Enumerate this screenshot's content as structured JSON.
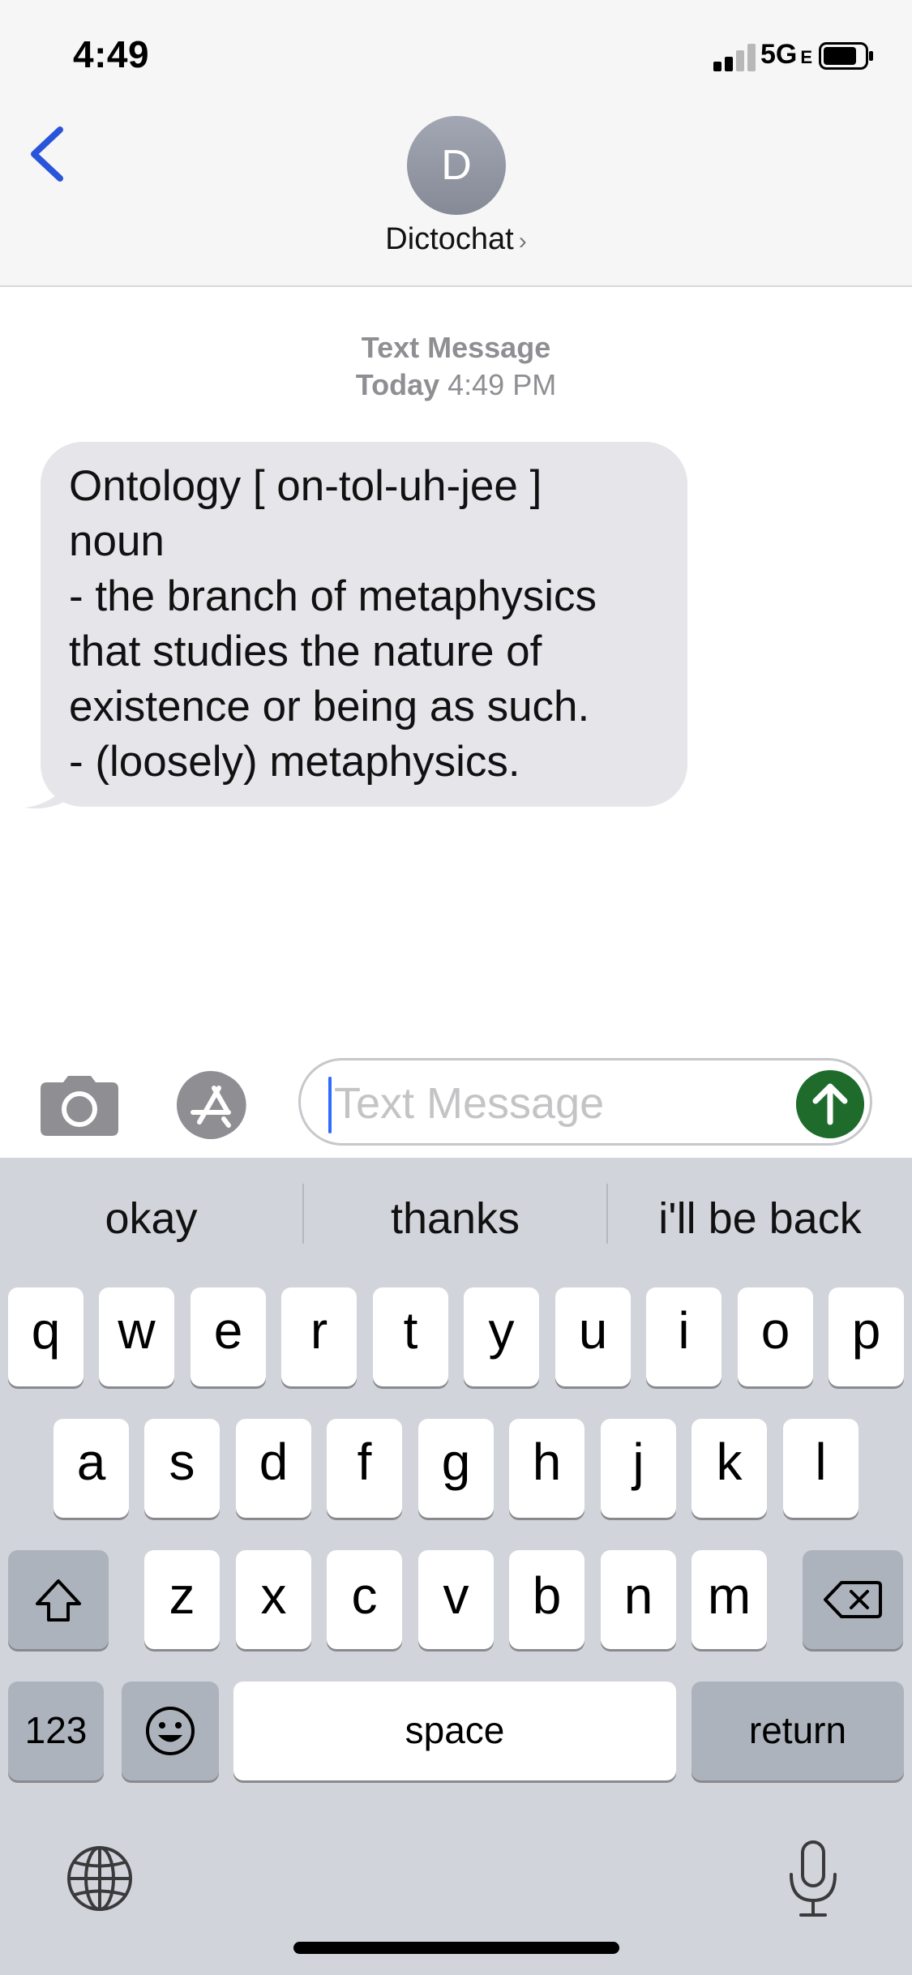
{
  "status_bar": {
    "time": "4:49",
    "network": "5G",
    "network_suffix": "E"
  },
  "header": {
    "avatar_initial": "D",
    "contact_name": "Dictochat",
    "contact_chevron": "›"
  },
  "conversation": {
    "service_label": "Text Message",
    "day_label": "Today",
    "time_label": "4:49 PM",
    "messages": [
      {
        "direction": "incoming",
        "text": "Ontology [ on-tol-uh-jee ]\nnoun\n- the branch of metaphysics\nthat studies the nature of\nexistence or being as such.\n- (loosely) metaphysics."
      }
    ]
  },
  "composer": {
    "placeholder": "Text Message"
  },
  "keyboard": {
    "suggestions": [
      "okay",
      "thanks",
      "i'll be back"
    ],
    "row1": [
      "q",
      "w",
      "e",
      "r",
      "t",
      "y",
      "u",
      "i",
      "o",
      "p"
    ],
    "row2": [
      "a",
      "s",
      "d",
      "f",
      "g",
      "h",
      "j",
      "k",
      "l"
    ],
    "row3": [
      "z",
      "x",
      "c",
      "v",
      "b",
      "n",
      "m"
    ],
    "numbers_label": "123",
    "space_label": "space",
    "return_label": "return"
  },
  "colors": {
    "accent": "#2f6bff",
    "send_button": "#1f6b2c",
    "bubble_incoming": "#e5e5ea",
    "keyboard_bg": "#d1d4da"
  },
  "icons": [
    "chevron-left-icon",
    "camera-icon",
    "app-store-icon",
    "arrow-up-icon",
    "shift-icon",
    "delete-icon",
    "emoji-icon",
    "globe-icon",
    "microphone-icon"
  ]
}
